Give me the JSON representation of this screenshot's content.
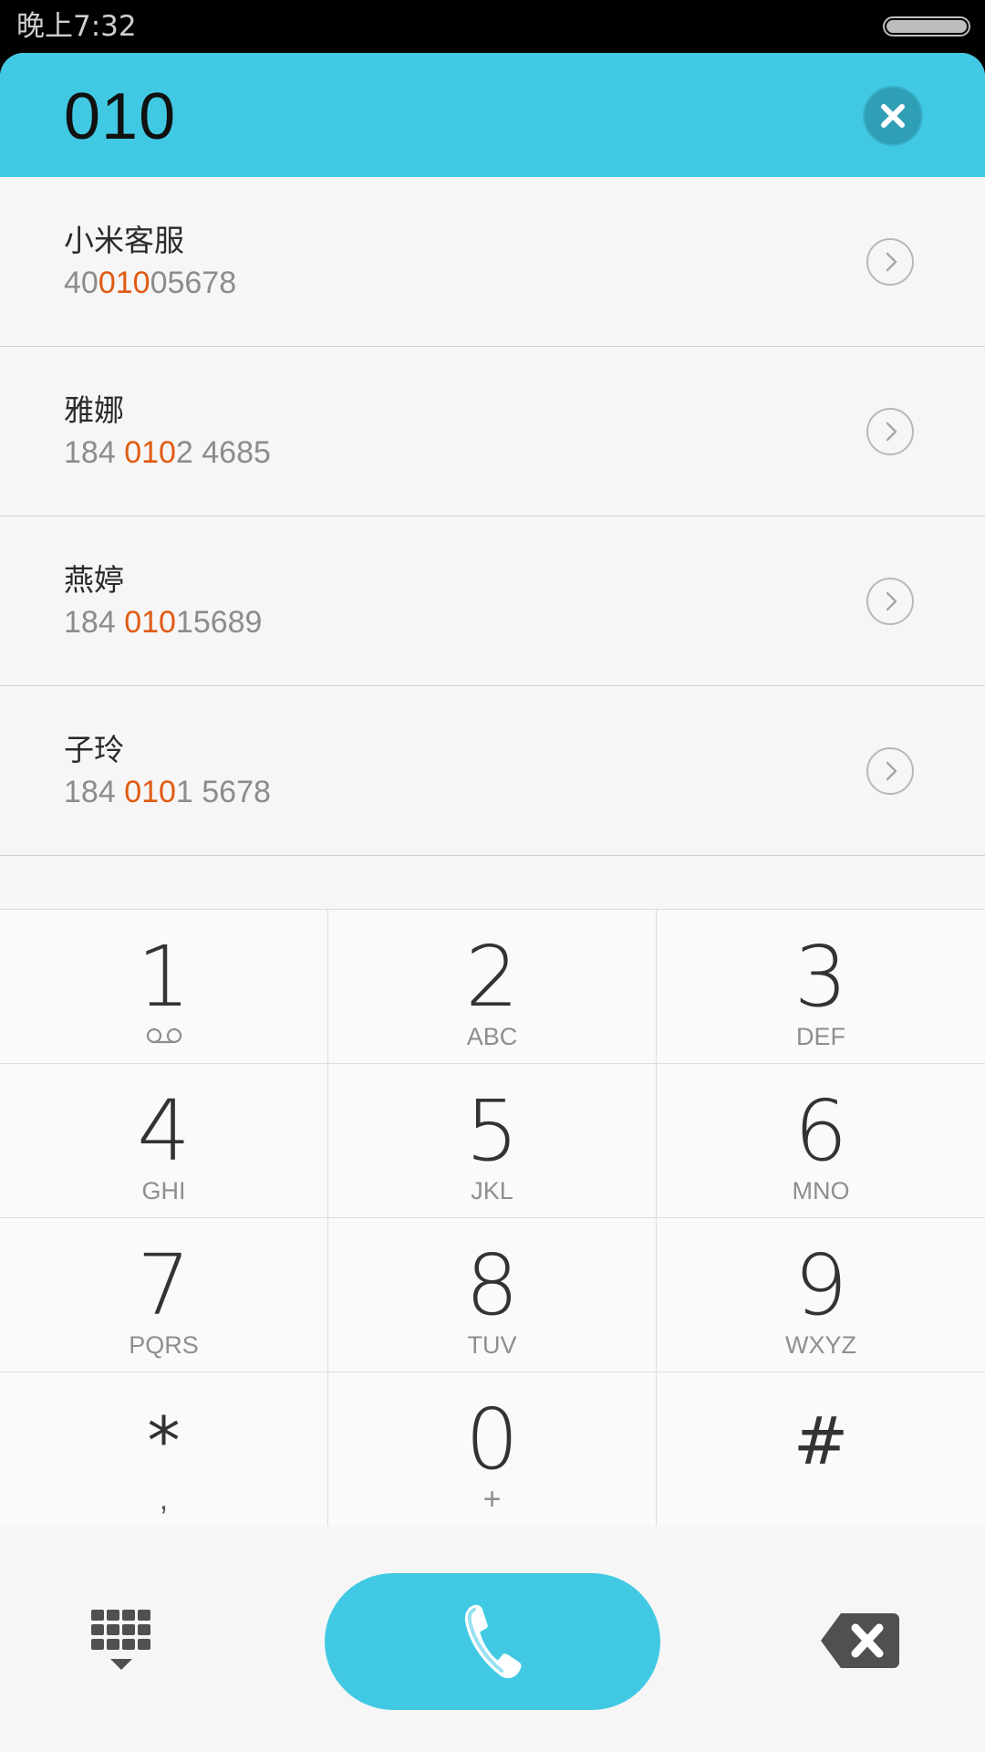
{
  "status_bar": {
    "time": "晚上7:32"
  },
  "header": {
    "dialed_number": "010"
  },
  "results": [
    {
      "name": "小米客服",
      "num_pre": "40",
      "num_match": "010",
      "num_post": "05678"
    },
    {
      "name": "雅娜",
      "num_pre": "184 ",
      "num_match": "010",
      "num_post": "2 4685"
    },
    {
      "name": "燕婷",
      "num_pre": "184 ",
      "num_match": "010",
      "num_post": "15689"
    },
    {
      "name": "子玲",
      "num_pre": "184 ",
      "num_match": "010",
      "num_post": "1 5678"
    }
  ],
  "keypad": {
    "keys": [
      {
        "digit": "1",
        "sub": ""
      },
      {
        "digit": "2",
        "sub": "ABC"
      },
      {
        "digit": "3",
        "sub": "DEF"
      },
      {
        "digit": "4",
        "sub": "GHI"
      },
      {
        "digit": "5",
        "sub": "JKL"
      },
      {
        "digit": "6",
        "sub": "MNO"
      },
      {
        "digit": "7",
        "sub": "PQRS"
      },
      {
        "digit": "8",
        "sub": "TUV"
      },
      {
        "digit": "9",
        "sub": "WXYZ"
      },
      {
        "digit": "*",
        "sub": ","
      },
      {
        "digit": "0",
        "sub": "+"
      },
      {
        "digit": "#",
        "sub": ""
      }
    ]
  },
  "colors": {
    "accent": "#41c9e4",
    "highlight": "#e05a12"
  },
  "icons": {
    "clear": "close-icon",
    "row_action": "chevron-right-icon",
    "voicemail": "voicemail-icon",
    "dialpad_toggle": "dialpad-icon",
    "call": "phone-icon",
    "backspace": "backspace-icon"
  }
}
